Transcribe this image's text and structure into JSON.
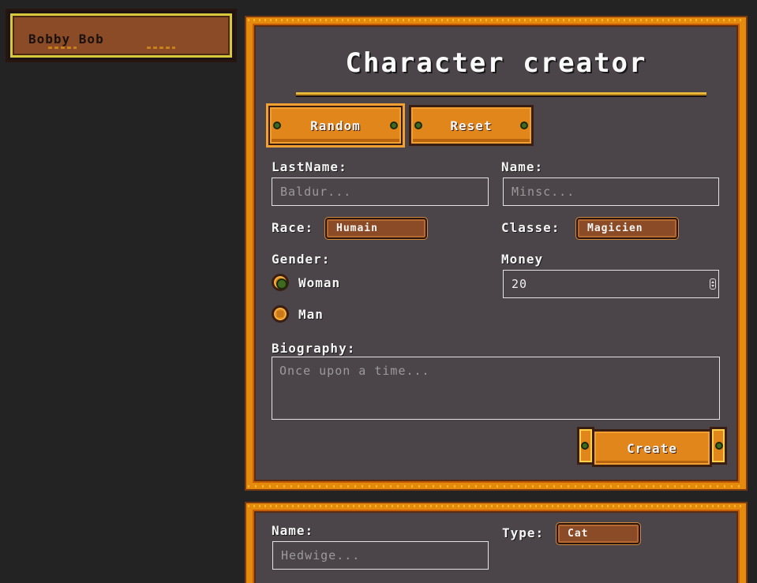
{
  "characters": [
    {
      "name": "Bobby Bob"
    }
  ],
  "creator": {
    "title": "Character creator",
    "random_label": "Random",
    "reset_label": "Reset",
    "lastname_label": "LastName:",
    "lastname_placeholder": "Baldur...",
    "name_label": "Name:",
    "name_placeholder": "Minsc...",
    "race_label": "Race:",
    "race_value": "Humain",
    "classe_label": "Classe:",
    "classe_value": "Magicien",
    "gender_label": "Gender:",
    "gender_options": [
      {
        "label": "Woman",
        "checked": true
      },
      {
        "label": "Man",
        "checked": false
      }
    ],
    "money_label": "Money",
    "money_value": "20",
    "biography_label": "Biography:",
    "biography_placeholder": "Once upon a time...",
    "create_label": "Create"
  },
  "pet": {
    "name_label": "Name:",
    "name_placeholder": "Hedwige...",
    "type_label": "Type:",
    "type_value": "Cat"
  },
  "colors": {
    "background": "#232323",
    "panel": "#4b4549",
    "accent_orange": "#e68a0e",
    "select_brown": "#8a4b26",
    "selected_border": "#d7c83d"
  }
}
